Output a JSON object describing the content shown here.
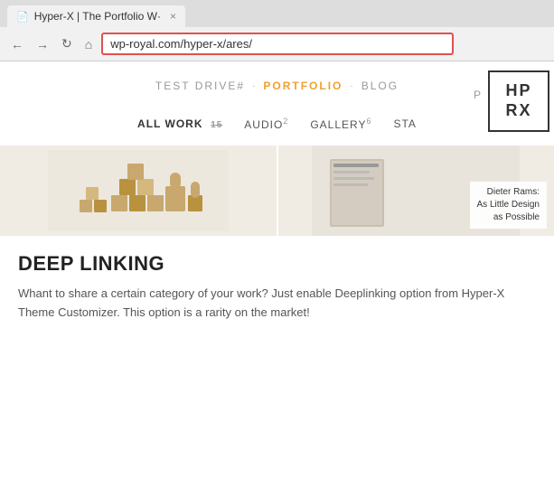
{
  "browser": {
    "tab_title": "Hyper-X | The Portfolio W·",
    "tab_icon": "📄",
    "close_label": "×",
    "back_label": "←",
    "forward_label": "→",
    "refresh_label": "↻",
    "home_label": "⌂",
    "url": "wp-royal.com/hyper-x/ares/"
  },
  "nav": {
    "test_drive": "TEST DRIVE#",
    "dot1": "·",
    "portfolio": "PORTFOLIO",
    "dot2": "·",
    "blog": "BLOG",
    "extra": "P",
    "logo_top": "HP",
    "logo_bottom": "RX"
  },
  "filters": {
    "all_work": "ALL WORK",
    "all_work_count": "15",
    "audio": "AUDIO",
    "audio_count": "2",
    "gallery": "GALLERY",
    "gallery_count": "6",
    "sta": "STA"
  },
  "portfolio": {
    "item1_alt": "toy blocks",
    "item2_title": "Dieter Rams:",
    "item2_subtitle": "As Little Design",
    "item2_suffix": "as Possible"
  },
  "description": {
    "heading": "DEEP LINKING",
    "body": "Whant to share a certain category of your work? Just enable Deeplinking option from Hyper-X Theme Customizer. This option is a rarity on the market!"
  }
}
